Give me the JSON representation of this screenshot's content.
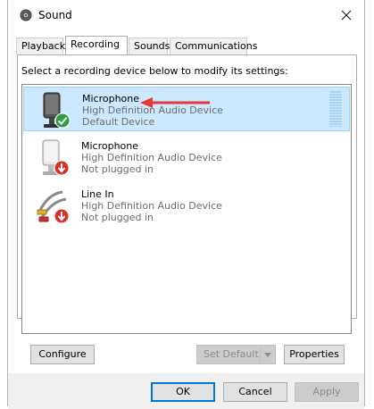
{
  "window": {
    "title": "Sound",
    "close_icon": "close-icon",
    "app_icon": "speaker-icon"
  },
  "tabs": [
    {
      "label": "Playback"
    },
    {
      "label": "Recording",
      "active": true
    },
    {
      "label": "Sounds"
    },
    {
      "label": "Communications"
    }
  ],
  "instruction": "Select a recording device below to modify its settings:",
  "devices": [
    {
      "name": "Microphone",
      "line1": "High Definition Audio Device",
      "line2": "Default Device",
      "status": "default",
      "selected": true,
      "icon": "microphone-icon"
    },
    {
      "name": "Microphone",
      "line1": "High Definition Audio Device",
      "line2": "Not plugged in",
      "status": "unplugged",
      "selected": false,
      "icon": "microphone-icon"
    },
    {
      "name": "Line In",
      "line1": "High Definition Audio Device",
      "line2": "Not plugged in",
      "status": "unplugged",
      "selected": false,
      "icon": "line-in-cable-icon"
    }
  ],
  "buttons": {
    "configure": "Configure",
    "set_default": "Set Default",
    "properties": "Properties",
    "ok": "OK",
    "cancel": "Cancel",
    "apply": "Apply"
  },
  "colors": {
    "selection": "#cce8ff",
    "accent": "#0078d7",
    "status_green": "#2e9e44",
    "status_red": "#d93025",
    "arrow_red": "#e53935"
  }
}
